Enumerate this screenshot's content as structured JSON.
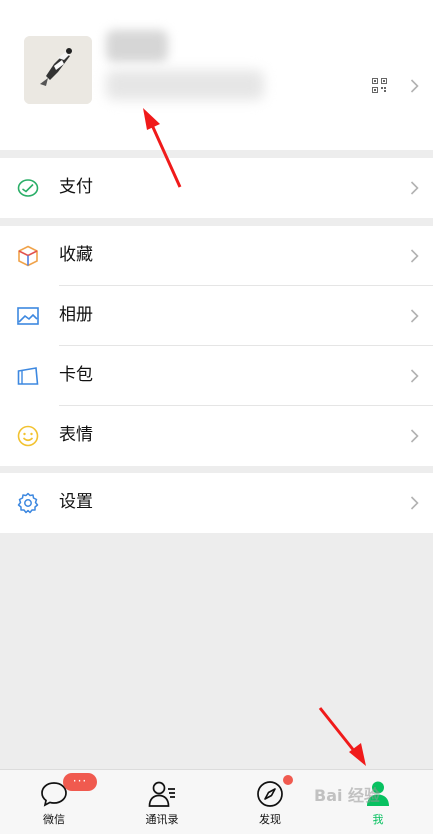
{
  "menu": {
    "pay": "支付",
    "favorites": "收藏",
    "album": "相册",
    "cards": "卡包",
    "stickers": "表情",
    "settings": "设置"
  },
  "tabbar": {
    "chats": "微信",
    "contacts": "通讯录",
    "discover": "发现",
    "me": "我",
    "chats_badge": "···"
  },
  "watermark": "Bai 经验",
  "colors": {
    "accent": "#07c160",
    "badge": "#f05a4f",
    "annotation_arrow": "#f01a1a"
  }
}
